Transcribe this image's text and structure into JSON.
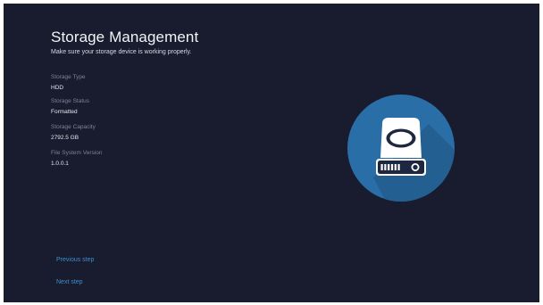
{
  "page": {
    "title": "Storage Management",
    "subtitle": "Make sure your storage device is working properly."
  },
  "storage_info": [
    {
      "label": "Storage Type",
      "value": "HDD"
    },
    {
      "label": "Storage Status",
      "value": "Formatted"
    },
    {
      "label": "Storage Capacity",
      "value": "2792.5 GB"
    },
    {
      "label": "File System Version",
      "value": "1.0.0.1"
    }
  ],
  "navigation": {
    "previous_label": "Previous step",
    "next_label": "Next step"
  },
  "icon": {
    "name": "hard-drive-icon"
  },
  "colors": {
    "background": "#181c2e",
    "accent_link": "#3d8fce",
    "badge_circle": "#2a6ea8",
    "badge_shadow": "#245f92",
    "drive_white": "#ffffff",
    "drive_navy": "#1e2740"
  }
}
